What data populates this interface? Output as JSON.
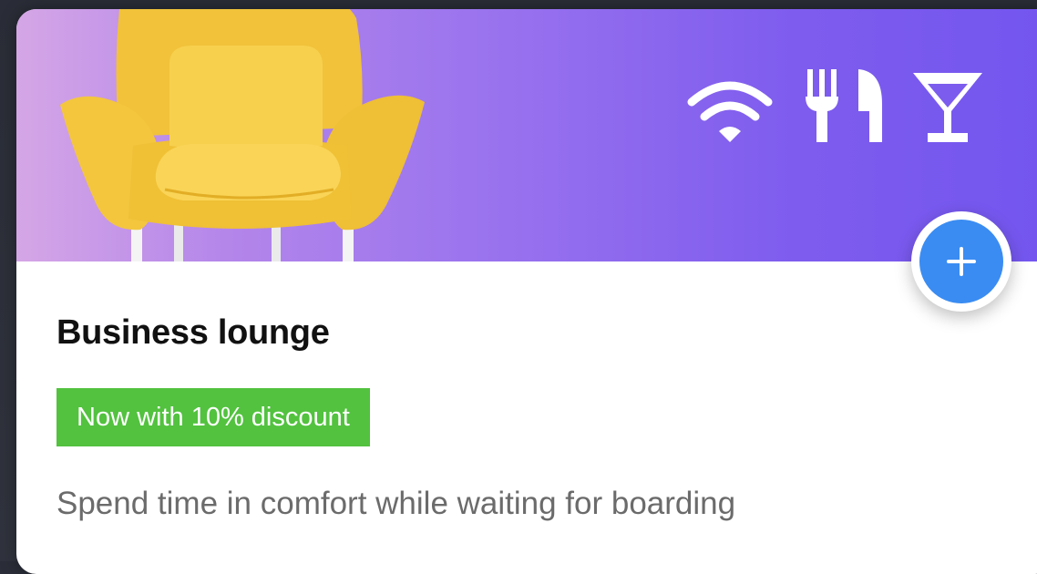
{
  "card": {
    "title": "Business lounge",
    "badge": "Now with 10% discount",
    "description": "Spend time in comfort while waiting for boarding",
    "image": "yellow-armchair",
    "amenities": [
      "wifi-icon",
      "cutlery-icon",
      "cocktail-icon"
    ],
    "action": "plus-icon"
  },
  "colors": {
    "hero_gradient_start": "#d5a6e6",
    "hero_gradient_end": "#7356ef",
    "accent_blue": "#3a8cf2",
    "badge_green": "#52c23f",
    "title_text": "#111111",
    "description_text": "#6b6b6b"
  }
}
